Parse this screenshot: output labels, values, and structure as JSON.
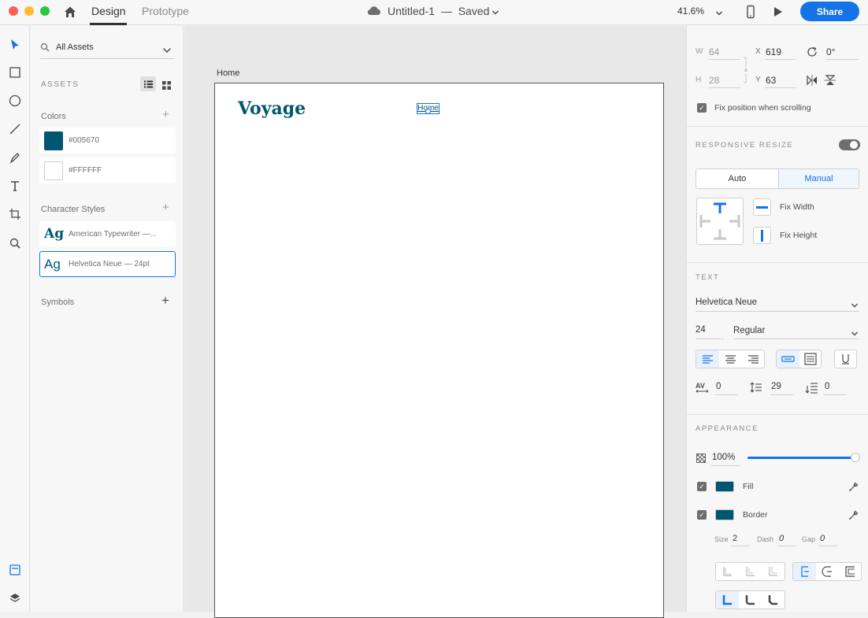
{
  "titlebar": {
    "tab_design": "Design",
    "tab_prototype": "Prototype",
    "doc_title": "Untitled-1",
    "doc_sep": "—",
    "doc_status": "Saved",
    "zoom": "41.6%",
    "share": "Share"
  },
  "assets": {
    "search_label": "All Assets",
    "header": "ASSETS",
    "colors_title": "Colors",
    "colors": [
      {
        "hex": "#005670",
        "label": "#005670"
      },
      {
        "hex": "#FFFFFF",
        "label": "#FFFFFF"
      }
    ],
    "char_styles_title": "Character Styles",
    "char_styles": [
      {
        "glyph": "Ag",
        "label": "American Typewriter —..."
      },
      {
        "glyph": "Ag",
        "label": "Helvetica Neue — 24pt"
      }
    ],
    "symbols_title": "Symbols"
  },
  "canvas": {
    "artboard_name": "Home",
    "logo_text": "Voyage",
    "nav_text": "Home",
    "brand_color": "#005670"
  },
  "props": {
    "w_label": "W",
    "w_value": "64",
    "x_label": "X",
    "x_value": "619",
    "rotation": "0°",
    "h_label": "H",
    "h_value": "28",
    "y_label": "Y",
    "y_value": "63",
    "fix_position": "Fix position when scrolling",
    "responsive_resize": "RESPONSIVE RESIZE",
    "auto": "Auto",
    "manual": "Manual",
    "fix_width": "Fix Width",
    "fix_height": "Fix Height",
    "text_header": "TEXT",
    "font_family": "Helvetica Neue",
    "font_size": "24",
    "font_weight": "Regular",
    "char_spacing": "0",
    "line_spacing": "29",
    "para_spacing": "0",
    "appearance_header": "APPEARANCE",
    "opacity": "100%",
    "opacity_value": 1.0,
    "fill_label": "Fill",
    "border_label": "Border",
    "fill_color": "#005670",
    "border_color": "#005670",
    "size_label": "Size",
    "size_value": "2",
    "dash_label": "Dash",
    "dash_value": "0",
    "gap_label": "Gap",
    "gap_value": "0"
  }
}
